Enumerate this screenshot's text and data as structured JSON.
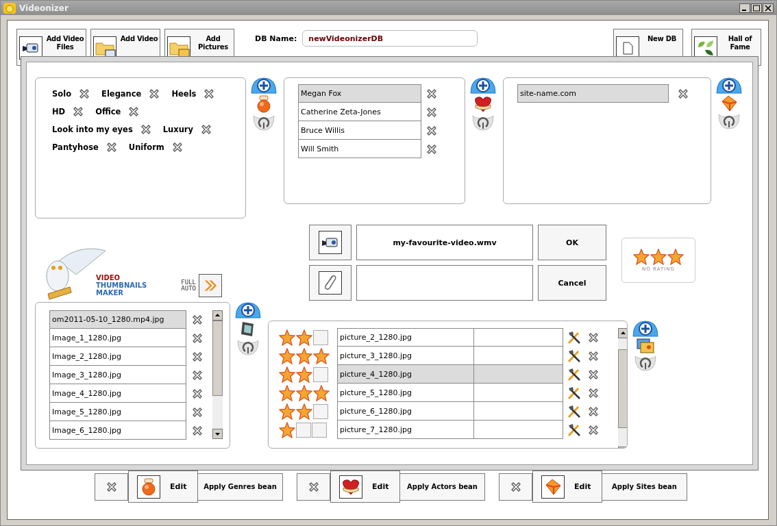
{
  "window": {
    "title": "Videonizer"
  },
  "toolbar": {
    "left_buttons": [
      {
        "label": "Add Video Files",
        "kind": "camera"
      },
      {
        "label": "Add Video",
        "kind": "folder"
      },
      {
        "label": "Add Pictures",
        "kind": "pictures"
      }
    ],
    "db_name": {
      "label": "DB Name:",
      "value": "newVideonizerDB"
    },
    "right_buttons": [
      {
        "label": "New DB",
        "kind": "page"
      },
      {
        "label": "Hall of Fame",
        "kind": "leaves"
      }
    ]
  },
  "dialog": {
    "genre_rows": [
      [
        "Solo",
        "Elegance",
        "Heels"
      ],
      [
        "HD",
        "Office"
      ],
      [
        "Look into my eyes",
        "Luxury"
      ],
      [
        "Pantyhose",
        "Uniform"
      ]
    ],
    "actors": [
      {
        "name": "Megan Fox",
        "selected": true
      },
      {
        "name": "Catherine Zeta-Jones",
        "selected": false
      },
      {
        "name": "Bruce Willis",
        "selected": false
      },
      {
        "name": "Will Smith",
        "selected": false
      }
    ],
    "sites": [
      {
        "name": "site-name.com",
        "selected": true
      }
    ],
    "logo": {
      "line1": "VIDEO",
      "line2": "THUMBNAILS",
      "line3": "MAKER"
    },
    "full_auto": [
      "FULL",
      "AUTO"
    ],
    "video_name": "my-favourite-video.wmv",
    "ok": "OK",
    "cancel": "Cancel",
    "rating": {
      "stars": 3,
      "caption": "NO RATING"
    },
    "files": [
      {
        "name": "om2011-05-10_1280.mp4.jpg",
        "selected": true
      },
      {
        "name": "Image_1_1280.jpg",
        "selected": false
      },
      {
        "name": "Image_2_1280.jpg",
        "selected": false
      },
      {
        "name": "Image_3_1280.jpg",
        "selected": false
      },
      {
        "name": "Image_4_1280.jpg",
        "selected": false
      },
      {
        "name": "Image_5_1280.jpg",
        "selected": false
      },
      {
        "name": "Image_6_1280.jpg",
        "selected": false
      }
    ],
    "pictures": [
      {
        "stars": 2,
        "name": "picture_2_1280.jpg",
        "selected": false
      },
      {
        "stars": 3,
        "name": "picture_3_1280.jpg",
        "selected": false
      },
      {
        "stars": 2,
        "name": "picture_4_1280.jpg",
        "selected": true
      },
      {
        "stars": 3,
        "name": "picture_5_1280.jpg",
        "selected": false
      },
      {
        "stars": 2,
        "name": "picture_6_1280.jpg",
        "selected": false
      },
      {
        "stars": 1,
        "name": "picture_7_1280.jpg",
        "selected": false
      }
    ]
  },
  "bottom_bar": [
    {
      "kind": "jar",
      "edit": "Edit",
      "apply": "Apply Genres bean"
    },
    {
      "kind": "heart",
      "edit": "Edit",
      "apply": "Apply Actors bean"
    },
    {
      "kind": "diamond",
      "edit": "Edit",
      "apply": "Apply Sites bean"
    }
  ]
}
